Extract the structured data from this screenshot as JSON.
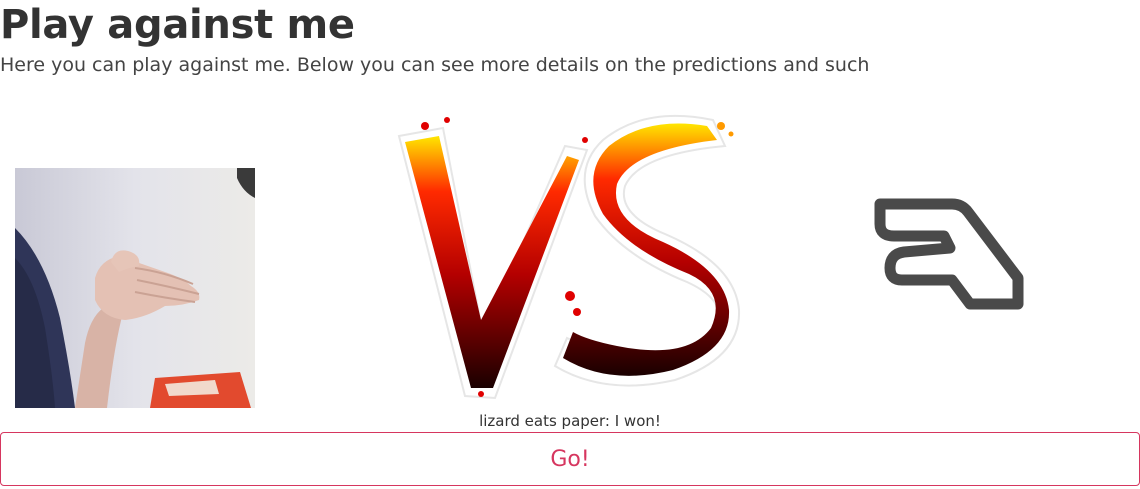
{
  "header": {
    "title": "Play against me",
    "subtitle": "Here you can play against me. Below you can see more details on the predictions and such"
  },
  "game": {
    "player_gesture": "paper",
    "computer_gesture_icon": "lizard-hand-icon",
    "vs_icon": "vs-icon",
    "result": "lizard eats paper: I won!"
  },
  "controls": {
    "go_label": "Go!"
  },
  "colors": {
    "accent": "#d6365f",
    "text": "#333333",
    "icon": "#4a4a4a"
  }
}
